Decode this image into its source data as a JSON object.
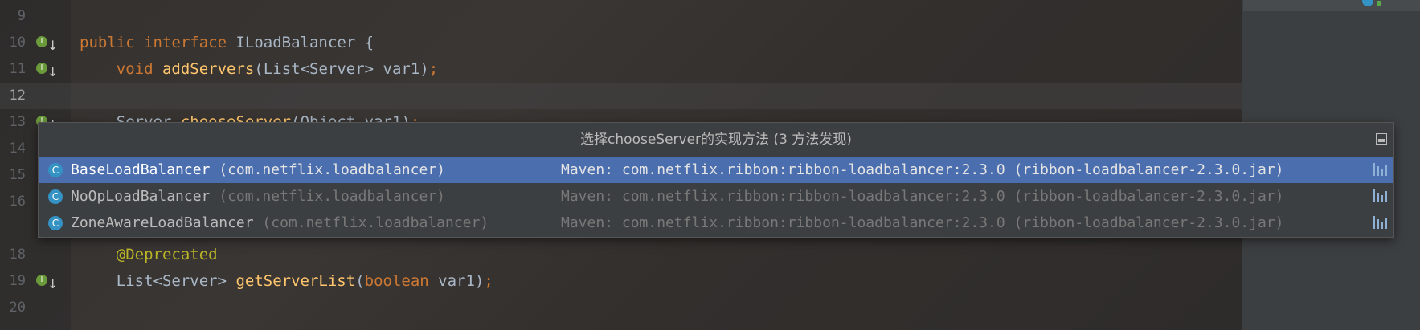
{
  "editor": {
    "lines": [
      {
        "num": "9",
        "current": false,
        "gutter_icon": false,
        "tokens": []
      },
      {
        "num": "10",
        "current": false,
        "gutter_icon": true,
        "tokens": [
          {
            "t": "public",
            "c": "kw"
          },
          {
            "t": " "
          },
          {
            "t": "interface",
            "c": "kw"
          },
          {
            "t": " ILoadBalancer {"
          }
        ]
      },
      {
        "num": "11",
        "current": false,
        "gutter_icon": true,
        "tokens": [
          {
            "t": "    "
          },
          {
            "t": "void",
            "c": "kw"
          },
          {
            "t": " "
          },
          {
            "t": "addServers",
            "c": "fn"
          },
          {
            "t": "(List<Server> var1)"
          },
          {
            "t": ";",
            "c": "kw"
          }
        ]
      },
      {
        "num": "12",
        "current": true,
        "gutter_icon": false,
        "tokens": []
      },
      {
        "num": "13",
        "current": false,
        "gutter_icon": true,
        "tokens": [
          {
            "t": "    Server "
          },
          {
            "t": "chooseServer",
            "c": "fn"
          },
          {
            "t": "(Object var1)"
          },
          {
            "t": ";",
            "c": "kw"
          }
        ]
      },
      {
        "num": "14",
        "current": false,
        "gutter_icon": false,
        "tokens": []
      },
      {
        "num": "15",
        "current": false,
        "gutter_icon": false,
        "tokens": []
      },
      {
        "num": "16",
        "current": false,
        "gutter_icon": false,
        "tokens": []
      },
      {
        "num": "",
        "current": false,
        "gutter_icon": false,
        "tokens": []
      },
      {
        "num": "18",
        "current": false,
        "gutter_icon": false,
        "tokens": [
          {
            "t": "    "
          },
          {
            "t": "@Deprecated",
            "c": "ann"
          }
        ]
      },
      {
        "num": "19",
        "current": false,
        "gutter_icon": true,
        "tokens": [
          {
            "t": "    List<Server> "
          },
          {
            "t": "getServerList",
            "c": "fn"
          },
          {
            "t": "("
          },
          {
            "t": "boolean",
            "c": "kw"
          },
          {
            "t": " var1)"
          },
          {
            "t": ";",
            "c": "kw"
          }
        ]
      },
      {
        "num": "20",
        "current": false,
        "gutter_icon": false,
        "tokens": []
      }
    ]
  },
  "popup": {
    "title": "选择chooseServer的实现方法 (3 方法发现)",
    "items": [
      {
        "class_name": "BaseLoadBalancer",
        "package": " (com.netflix.loadbalancer)",
        "location": "Maven: com.netflix.ribbon:ribbon-loadbalancer:2.3.0 (ribbon-loadbalancer-2.3.0.jar)",
        "selected": true
      },
      {
        "class_name": "NoOpLoadBalancer",
        "package": " (com.netflix.loadbalancer)",
        "location": "Maven: com.netflix.ribbon:ribbon-loadbalancer:2.3.0 (ribbon-loadbalancer-2.3.0.jar)",
        "selected": false
      },
      {
        "class_name": "ZoneAwareLoadBalancer",
        "package": " (com.netflix.loadbalancer)",
        "location": "Maven: com.netflix.ribbon:ribbon-loadbalancer:2.3.0 (ribbon-loadbalancer-2.3.0.jar)",
        "selected": false
      }
    ]
  },
  "icons": {
    "class_icon_letter": "C",
    "gutter_icon_letter": "I",
    "gutter_arrow": "↓"
  },
  "colors": {
    "selection": "#4b6eaf",
    "keyword": "#cc7832",
    "function": "#ffc66d",
    "annotation": "#bbb529",
    "class_icon": "#3592c4"
  }
}
